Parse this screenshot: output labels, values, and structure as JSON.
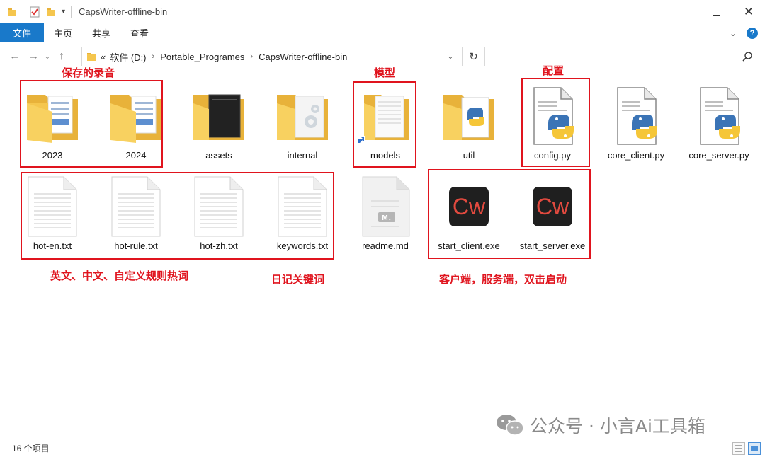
{
  "window": {
    "title": "CapsWriter-offline-bin"
  },
  "ribbon": {
    "tabs": [
      "文件",
      "主页",
      "共享",
      "查看"
    ]
  },
  "address": {
    "prefix": "«",
    "segments": [
      "软件 (D:)",
      "Portable_Programes",
      "CapsWriter-offline-bin"
    ],
    "search_placeholder": ""
  },
  "items": [
    {
      "name": "2023",
      "type": "folder-audio"
    },
    {
      "name": "2024",
      "type": "folder-audio"
    },
    {
      "name": "assets",
      "type": "folder-dark"
    },
    {
      "name": "internal",
      "type": "folder-gear"
    },
    {
      "name": "models",
      "type": "folder-doc"
    },
    {
      "name": "util",
      "type": "folder-python"
    },
    {
      "name": "config.py",
      "type": "python"
    },
    {
      "name": "core_client.py",
      "type": "python"
    },
    {
      "name": "core_server.py",
      "type": "python"
    },
    {
      "name": "hot-en.txt",
      "type": "text"
    },
    {
      "name": "hot-rule.txt",
      "type": "text"
    },
    {
      "name": "hot-zh.txt",
      "type": "text"
    },
    {
      "name": "keywords.txt",
      "type": "text"
    },
    {
      "name": "readme.md",
      "type": "markdown"
    },
    {
      "name": "start_client.exe",
      "type": "exe"
    },
    {
      "name": "start_server.exe",
      "type": "exe"
    }
  ],
  "exe_icon_text": "Cw",
  "md_icon_text": "M↓",
  "annotations": {
    "recordings": "保存的录音",
    "models": "模型",
    "config": "配置",
    "hotwords": "英文、中文、自定义规则热词",
    "diary": "日记关键词",
    "launch": "客户端，服务端，双击启动"
  },
  "status": {
    "count": "16 个项目"
  },
  "watermark": {
    "text": "公众号 · 小言Ai工具箱"
  },
  "colors": {
    "accent": "#1979ca",
    "annotation": "#e0141e",
    "folder": "#f5c64e"
  }
}
